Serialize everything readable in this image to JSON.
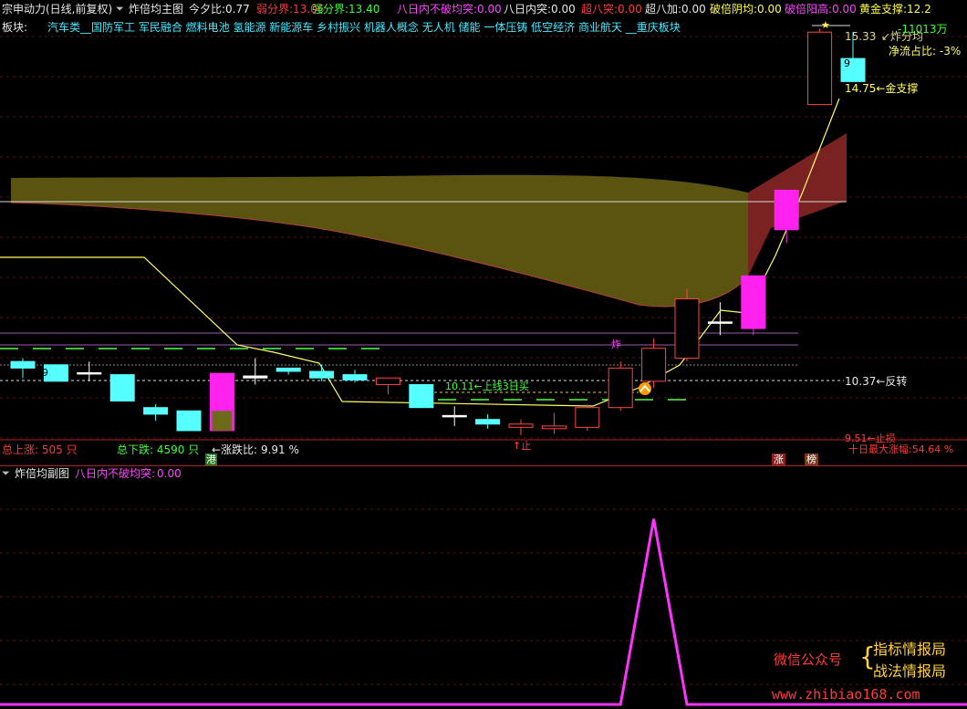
{
  "header": {
    "symbol": "宗申动力(日线,前复权)",
    "indicator_name": "炸倍均主图",
    "items": [
      {
        "label": "今夕比:",
        "value": "0.77",
        "color": "#e8e8e8"
      },
      {
        "label": "弱分界:",
        "value": "13.06",
        "color": "#ff3b3b"
      },
      {
        "label": "强分界:",
        "value": "13.40",
        "color": "#3cff3c"
      },
      {
        "label": "八日内不破均突:",
        "value": "0.00",
        "color": "#ff44ff"
      },
      {
        "label": "八日内突:",
        "value": "0.00",
        "color": "#e8e8e8"
      },
      {
        "label": "超八突:",
        "value": "0.00",
        "color": "#ff3b3b"
      },
      {
        "label": "超八加:",
        "value": "0.00",
        "color": "#e8e8e8"
      },
      {
        "label": "破倍阴均:",
        "value": "0.00",
        "color": "#ffff44"
      },
      {
        "label": "破倍阳高:",
        "value": "0.00",
        "color": "#ff44ff"
      },
      {
        "label": "黄金支撑:",
        "value": "12.2",
        "color": "#ffff44"
      }
    ]
  },
  "sectors": {
    "label": "板块:",
    "list": "汽车类__国防军工 军民融合 燃料电池 氢能源 新能源车 乡村振兴 机器人概念 无人机 储能 一体压铸 低空经济 商业航天 __重庆板块"
  },
  "right_labels": {
    "stars": "★",
    "top_value": "15.33",
    "top_tag": "↙炸分均",
    "flow_value": "-11013万",
    "flow_ratio": "净流占比: -3%",
    "gold_support": "14.75←金支撑",
    "reversal": "10.37←反转",
    "stop": "9.51←止损",
    "max_rise": "十日最大涨幅:54.64 %"
  },
  "chart_annotations": {
    "upline": "10.11←上线3日买",
    "zha_marker": "炸",
    "candle_9_a": "9",
    "candle_9_b": "9",
    "stop_mark": "↑止",
    "gang": "港",
    "zhang": "涨",
    "bang": "榜"
  },
  "stats": {
    "up_label": "总上涨:",
    "up_value": "505 只",
    "down_label": "总下跌:",
    "down_value": "4590 只",
    "ratio_label": "←涨跌比:",
    "ratio_value": "9.91 %"
  },
  "sub_header": {
    "indicator_name": "炸倍均副图",
    "label": "八日内不破均突:",
    "value": "0.00"
  },
  "watermark": {
    "account_label": "微信公众号",
    "line1": "指标情报局",
    "line2": "战法情报局",
    "url": "www.zhibiao168.com"
  },
  "chart_data": {
    "type": "candlestick",
    "price_range": [
      9.3,
      15.7
    ],
    "candles": [
      {
        "o": 10.6,
        "c": 10.5,
        "h": 10.65,
        "l": 10.35,
        "dir": "down"
      },
      {
        "o": 10.55,
        "c": 10.3,
        "h": 10.55,
        "l": 10.3,
        "dir": "down",
        "label": "9"
      },
      {
        "o": 10.43,
        "c": 10.43,
        "h": 10.6,
        "l": 10.3,
        "dir": "flat"
      },
      {
        "o": 10.4,
        "c": 10.0,
        "h": 10.4,
        "l": 10.0,
        "dir": "down"
      },
      {
        "o": 9.9,
        "c": 9.8,
        "h": 9.95,
        "l": 9.7,
        "dir": "down"
      },
      {
        "o": 9.85,
        "c": 9.55,
        "h": 9.85,
        "l": 9.55,
        "dir": "down"
      },
      {
        "o": 9.55,
        "c": 10.42,
        "h": 10.42,
        "l": 9.55,
        "dir": "up",
        "limit": true
      },
      {
        "o": 10.35,
        "c": 10.38,
        "h": 10.65,
        "l": 10.25,
        "dir": "flat"
      },
      {
        "o": 10.5,
        "c": 10.45,
        "h": 10.5,
        "l": 10.4,
        "dir": "down"
      },
      {
        "o": 10.45,
        "c": 10.35,
        "h": 10.55,
        "l": 10.3,
        "dir": "down"
      },
      {
        "o": 10.4,
        "c": 10.32,
        "h": 10.47,
        "l": 10.28,
        "dir": "down"
      },
      {
        "o": 10.25,
        "c": 10.35,
        "h": 10.35,
        "l": 10.1,
        "dir": "up"
      },
      {
        "o": 10.25,
        "c": 9.9,
        "h": 10.25,
        "l": 9.9,
        "dir": "down"
      },
      {
        "o": 9.78,
        "c": 9.78,
        "h": 9.92,
        "l": 9.62,
        "dir": "flat"
      },
      {
        "o": 9.72,
        "c": 9.65,
        "h": 9.8,
        "l": 9.58,
        "dir": "down"
      },
      {
        "o": 9.6,
        "c": 9.65,
        "h": 9.72,
        "l": 9.48,
        "dir": "up"
      },
      {
        "o": 9.58,
        "c": 9.62,
        "h": 9.82,
        "l": 9.5,
        "dir": "up"
      },
      {
        "o": 9.6,
        "c": 9.9,
        "h": 9.95,
        "l": 9.55,
        "dir": "up"
      },
      {
        "o": 9.9,
        "c": 10.5,
        "h": 10.6,
        "l": 9.85,
        "dir": "up"
      },
      {
        "o": 10.3,
        "c": 10.8,
        "h": 10.95,
        "l": 10.2,
        "dir": "up"
      },
      {
        "o": 10.65,
        "c": 11.55,
        "h": 11.7,
        "l": 10.6,
        "dir": "up"
      },
      {
        "o": 11.2,
        "c": 11.2,
        "h": 11.5,
        "l": 11.0,
        "dir": "flat"
      },
      {
        "o": 11.1,
        "c": 11.9,
        "h": 11.9,
        "l": 11.0,
        "dir": "up",
        "limit": true
      },
      {
        "o": 12.6,
        "c": 13.2,
        "h": 13.2,
        "l": 12.4,
        "dir": "up",
        "limit": true
      },
      {
        "o": 14.5,
        "c": 15.6,
        "h": 15.65,
        "l": 14.5,
        "dir": "up"
      },
      {
        "o": 15.2,
        "c": 14.85,
        "h": 15.6,
        "l": 14.85,
        "dir": "down",
        "label": "9"
      }
    ],
    "sub_series": {
      "name": "八日内不破均突",
      "values": [
        0,
        0,
        0,
        0,
        0,
        0,
        0,
        0,
        0,
        0,
        0,
        0,
        0,
        0,
        0,
        0,
        0,
        0,
        0,
        1,
        0,
        0,
        0,
        0,
        0,
        0
      ],
      "ylim": [
        0,
        1.2
      ]
    }
  }
}
